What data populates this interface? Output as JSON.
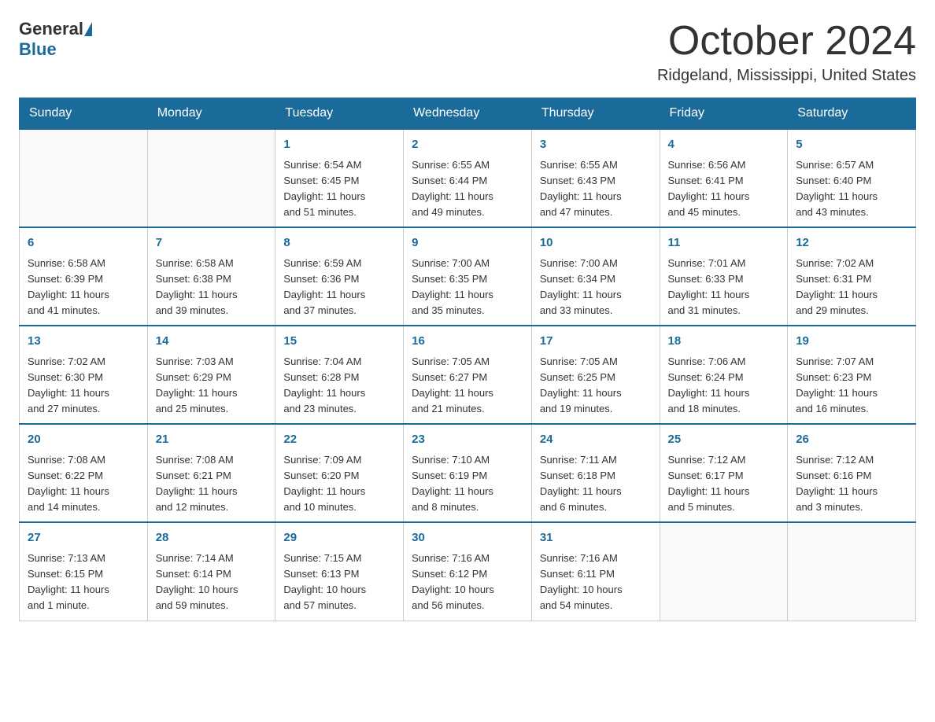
{
  "header": {
    "logo": {
      "general": "General",
      "blue": "Blue"
    },
    "title": "October 2024",
    "subtitle": "Ridgeland, Mississippi, United States"
  },
  "weekdays": [
    "Sunday",
    "Monday",
    "Tuesday",
    "Wednesday",
    "Thursday",
    "Friday",
    "Saturday"
  ],
  "weeks": [
    [
      {
        "day": "",
        "info": ""
      },
      {
        "day": "",
        "info": ""
      },
      {
        "day": "1",
        "info": "Sunrise: 6:54 AM\nSunset: 6:45 PM\nDaylight: 11 hours\nand 51 minutes."
      },
      {
        "day": "2",
        "info": "Sunrise: 6:55 AM\nSunset: 6:44 PM\nDaylight: 11 hours\nand 49 minutes."
      },
      {
        "day": "3",
        "info": "Sunrise: 6:55 AM\nSunset: 6:43 PM\nDaylight: 11 hours\nand 47 minutes."
      },
      {
        "day": "4",
        "info": "Sunrise: 6:56 AM\nSunset: 6:41 PM\nDaylight: 11 hours\nand 45 minutes."
      },
      {
        "day": "5",
        "info": "Sunrise: 6:57 AM\nSunset: 6:40 PM\nDaylight: 11 hours\nand 43 minutes."
      }
    ],
    [
      {
        "day": "6",
        "info": "Sunrise: 6:58 AM\nSunset: 6:39 PM\nDaylight: 11 hours\nand 41 minutes."
      },
      {
        "day": "7",
        "info": "Sunrise: 6:58 AM\nSunset: 6:38 PM\nDaylight: 11 hours\nand 39 minutes."
      },
      {
        "day": "8",
        "info": "Sunrise: 6:59 AM\nSunset: 6:36 PM\nDaylight: 11 hours\nand 37 minutes."
      },
      {
        "day": "9",
        "info": "Sunrise: 7:00 AM\nSunset: 6:35 PM\nDaylight: 11 hours\nand 35 minutes."
      },
      {
        "day": "10",
        "info": "Sunrise: 7:00 AM\nSunset: 6:34 PM\nDaylight: 11 hours\nand 33 minutes."
      },
      {
        "day": "11",
        "info": "Sunrise: 7:01 AM\nSunset: 6:33 PM\nDaylight: 11 hours\nand 31 minutes."
      },
      {
        "day": "12",
        "info": "Sunrise: 7:02 AM\nSunset: 6:31 PM\nDaylight: 11 hours\nand 29 minutes."
      }
    ],
    [
      {
        "day": "13",
        "info": "Sunrise: 7:02 AM\nSunset: 6:30 PM\nDaylight: 11 hours\nand 27 minutes."
      },
      {
        "day": "14",
        "info": "Sunrise: 7:03 AM\nSunset: 6:29 PM\nDaylight: 11 hours\nand 25 minutes."
      },
      {
        "day": "15",
        "info": "Sunrise: 7:04 AM\nSunset: 6:28 PM\nDaylight: 11 hours\nand 23 minutes."
      },
      {
        "day": "16",
        "info": "Sunrise: 7:05 AM\nSunset: 6:27 PM\nDaylight: 11 hours\nand 21 minutes."
      },
      {
        "day": "17",
        "info": "Sunrise: 7:05 AM\nSunset: 6:25 PM\nDaylight: 11 hours\nand 19 minutes."
      },
      {
        "day": "18",
        "info": "Sunrise: 7:06 AM\nSunset: 6:24 PM\nDaylight: 11 hours\nand 18 minutes."
      },
      {
        "day": "19",
        "info": "Sunrise: 7:07 AM\nSunset: 6:23 PM\nDaylight: 11 hours\nand 16 minutes."
      }
    ],
    [
      {
        "day": "20",
        "info": "Sunrise: 7:08 AM\nSunset: 6:22 PM\nDaylight: 11 hours\nand 14 minutes."
      },
      {
        "day": "21",
        "info": "Sunrise: 7:08 AM\nSunset: 6:21 PM\nDaylight: 11 hours\nand 12 minutes."
      },
      {
        "day": "22",
        "info": "Sunrise: 7:09 AM\nSunset: 6:20 PM\nDaylight: 11 hours\nand 10 minutes."
      },
      {
        "day": "23",
        "info": "Sunrise: 7:10 AM\nSunset: 6:19 PM\nDaylight: 11 hours\nand 8 minutes."
      },
      {
        "day": "24",
        "info": "Sunrise: 7:11 AM\nSunset: 6:18 PM\nDaylight: 11 hours\nand 6 minutes."
      },
      {
        "day": "25",
        "info": "Sunrise: 7:12 AM\nSunset: 6:17 PM\nDaylight: 11 hours\nand 5 minutes."
      },
      {
        "day": "26",
        "info": "Sunrise: 7:12 AM\nSunset: 6:16 PM\nDaylight: 11 hours\nand 3 minutes."
      }
    ],
    [
      {
        "day": "27",
        "info": "Sunrise: 7:13 AM\nSunset: 6:15 PM\nDaylight: 11 hours\nand 1 minute."
      },
      {
        "day": "28",
        "info": "Sunrise: 7:14 AM\nSunset: 6:14 PM\nDaylight: 10 hours\nand 59 minutes."
      },
      {
        "day": "29",
        "info": "Sunrise: 7:15 AM\nSunset: 6:13 PM\nDaylight: 10 hours\nand 57 minutes."
      },
      {
        "day": "30",
        "info": "Sunrise: 7:16 AM\nSunset: 6:12 PM\nDaylight: 10 hours\nand 56 minutes."
      },
      {
        "day": "31",
        "info": "Sunrise: 7:16 AM\nSunset: 6:11 PM\nDaylight: 10 hours\nand 54 minutes."
      },
      {
        "day": "",
        "info": ""
      },
      {
        "day": "",
        "info": ""
      }
    ]
  ]
}
